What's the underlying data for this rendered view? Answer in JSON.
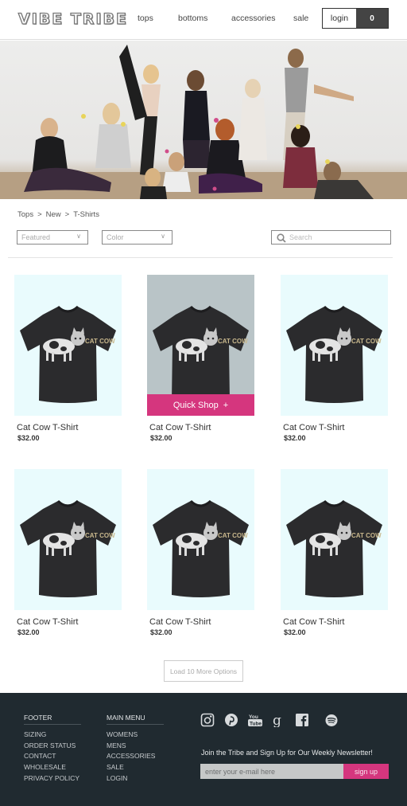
{
  "header": {
    "logo": "VIBE TRIBE",
    "nav": [
      "tops",
      "bottoms",
      "accessories",
      "sale"
    ],
    "login_label": "login",
    "cart_count": "0"
  },
  "breadcrumb": [
    "Tops",
    ">",
    "New",
    ">",
    "T-Shirts"
  ],
  "filters": {
    "sort_value": "Featured",
    "color_value": "Color",
    "search_placeholder": "Search"
  },
  "products": [
    {
      "name": "Cat Cow T-Shirt",
      "price": "$32.00",
      "print": "CAT COW"
    },
    {
      "name": "Cat Cow T-Shirt",
      "price": "$32.00",
      "print": "CAT COW",
      "hover": true,
      "quick_shop": "Quick Shop",
      "quick_shop_icon": "+"
    },
    {
      "name": "Cat Cow T-Shirt",
      "price": "$32.00",
      "print": "CAT COW"
    },
    {
      "name": "Cat Cow T-Shirt",
      "price": "$32.00",
      "print": "CAT COW"
    },
    {
      "name": "Cat Cow T-Shirt",
      "price": "$32.00",
      "print": "CAT COW"
    },
    {
      "name": "Cat Cow T-Shirt",
      "price": "$32.00",
      "print": "CAT COW"
    }
  ],
  "load_more": "Load 10 More Options",
  "footer": {
    "col1_title": "FOOTER",
    "col1_links": [
      "SIZING",
      "ORDER STATUS",
      "CONTACT",
      "WHOLESALE",
      "PRIVACY POLICY"
    ],
    "col2_title": "MAIN MENU",
    "col2_links": [
      "WOMENS",
      "MENS",
      "ACCESSORIES",
      "SALE",
      "LOGIN"
    ],
    "social_icons": [
      "instagram-icon",
      "pinterest-icon",
      "youtube-icon",
      "google-icon",
      "facebook-icon",
      "spotify-icon"
    ],
    "newsletter_text": "Join the Tribe and Sign Up for Our Weekly Newsletter!",
    "email_placeholder": "enter your e-mail here",
    "signup_label": "sign up"
  },
  "colors": {
    "accent": "#d5367e",
    "footer_bg": "#202a30",
    "product_bg": "#e9fbfd"
  }
}
